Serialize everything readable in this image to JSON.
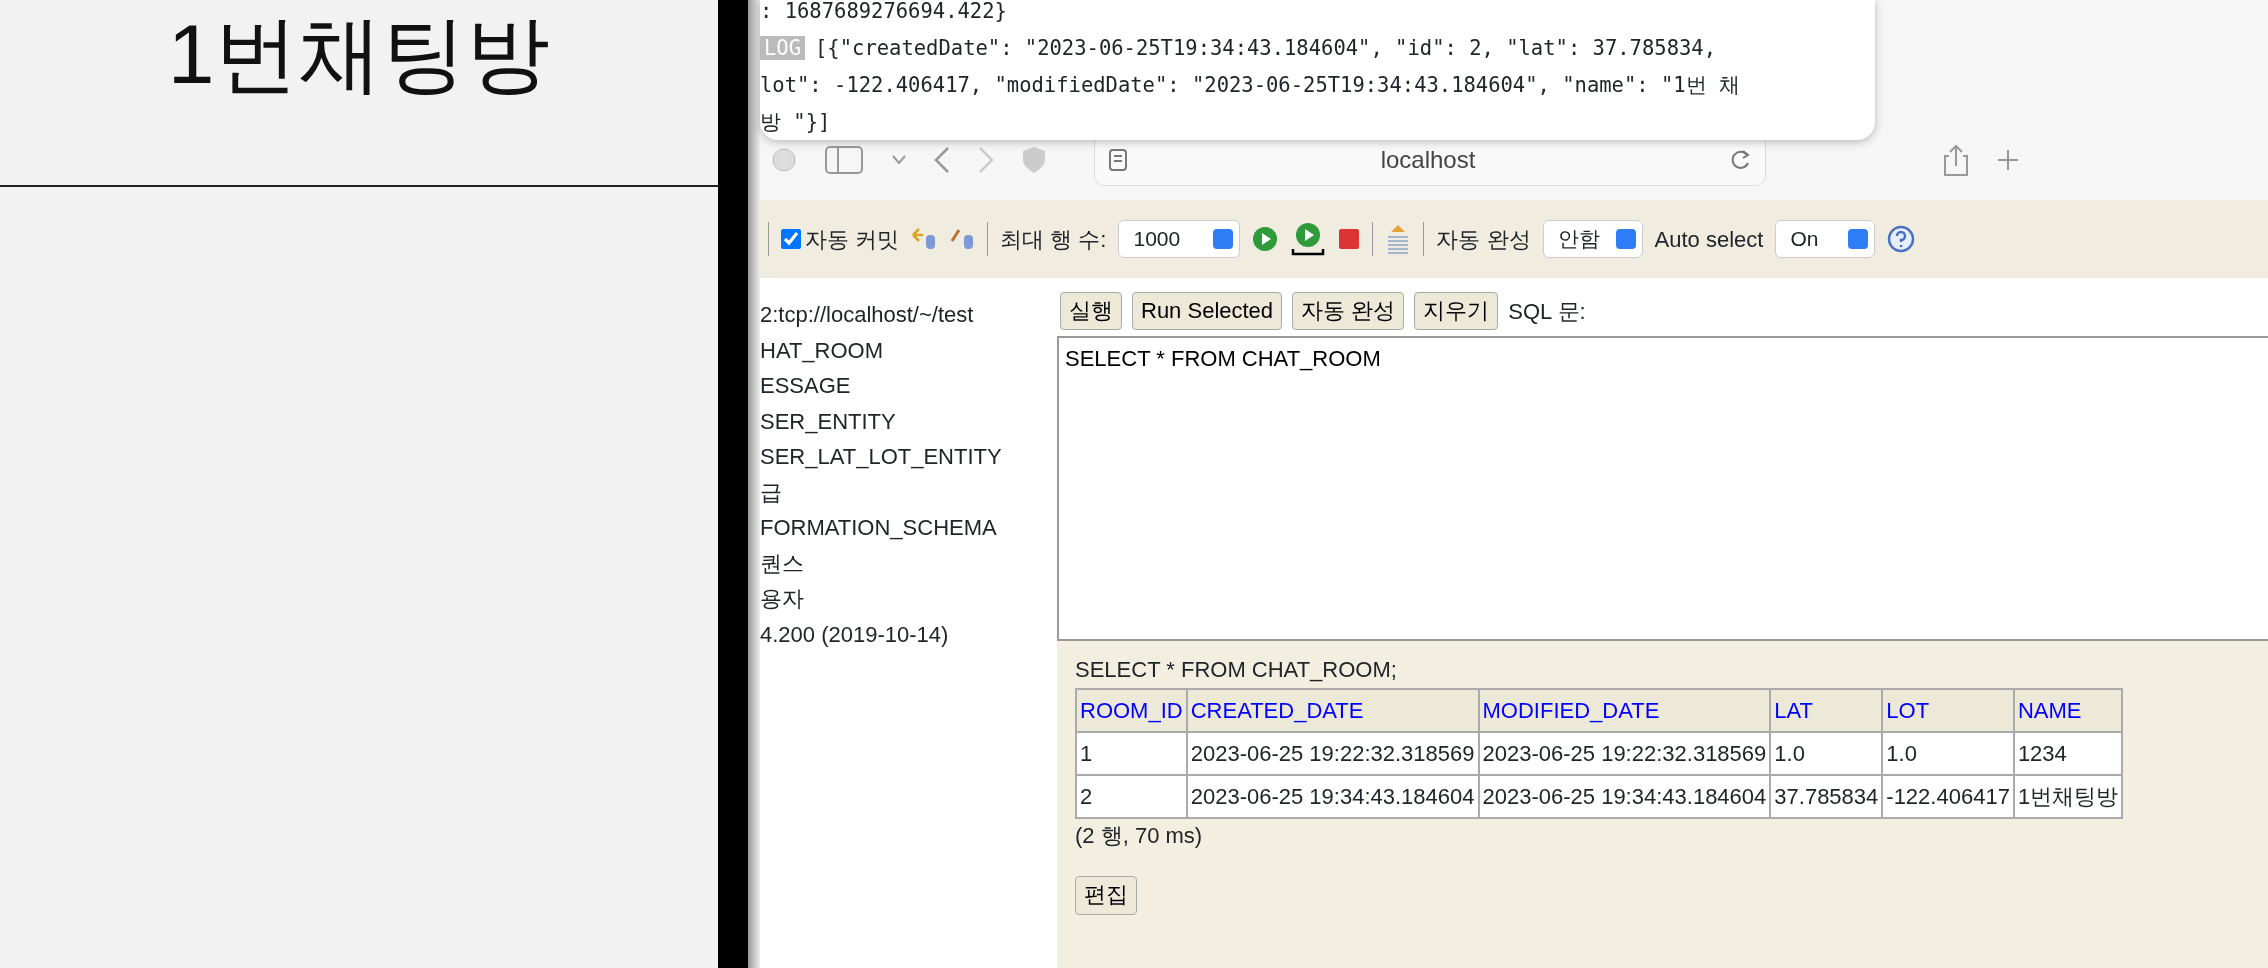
{
  "left_panel": {
    "title": "1번채팅방"
  },
  "console": {
    "lines": [
      {
        "kind": "text",
        "text": ": 1687689276694.422}"
      },
      {
        "kind": "log",
        "badge": "LOG",
        "text": "[{\"createdDate\": \"2023-06-25T19:34:43.184604\", \"id\": 2, \"lat\": 37.785834,"
      },
      {
        "kind": "text",
        "text": "lot\": -122.406417, \"modifiedDate\": \"2023-06-25T19:34:43.184604\", \"name\": \"1번 채"
      },
      {
        "kind": "text",
        "text": "방 \"}]"
      }
    ]
  },
  "browser": {
    "address": "localhost"
  },
  "h2_toolbar": {
    "auto_commit": {
      "label": "자동 커밋",
      "checked": true
    },
    "max_rows": {
      "label": "최대 행 수:",
      "value": "1000"
    },
    "autocomplete": {
      "label": "자동 완성",
      "value": "안함"
    },
    "auto_select": {
      "label": "Auto select",
      "value": "On"
    }
  },
  "tree": {
    "items": [
      "2:tcp://localhost/~/test",
      "HAT_ROOM",
      "ESSAGE",
      "SER_ENTITY",
      "SER_LAT_LOT_ENTITY",
      "급",
      "FORMATION_SCHEMA",
      "퀀스",
      "용자",
      "4.200 (2019-10-14)"
    ]
  },
  "query": {
    "buttons": [
      "실행",
      "Run Selected",
      "자동 완성",
      "지우기"
    ],
    "label": "SQL 문:",
    "sql": "SELECT * FROM CHAT_ROOM"
  },
  "result": {
    "statement": "SELECT * FROM CHAT_ROOM;",
    "columns": [
      "ROOM_ID",
      "CREATED_DATE",
      "MODIFIED_DATE",
      "LAT",
      "LOT",
      "NAME"
    ],
    "rows": [
      [
        "1",
        "2023-06-25 19:22:32.318569",
        "2023-06-25 19:22:32.318569",
        "1.0",
        "1.0",
        "1234"
      ],
      [
        "2",
        "2023-06-25 19:34:43.184604",
        "2023-06-25 19:34:43.184604",
        "37.785834",
        "-122.406417",
        "1번채팅방"
      ]
    ],
    "summary": "(2 행, 70 ms)",
    "edit_button": "편집"
  }
}
